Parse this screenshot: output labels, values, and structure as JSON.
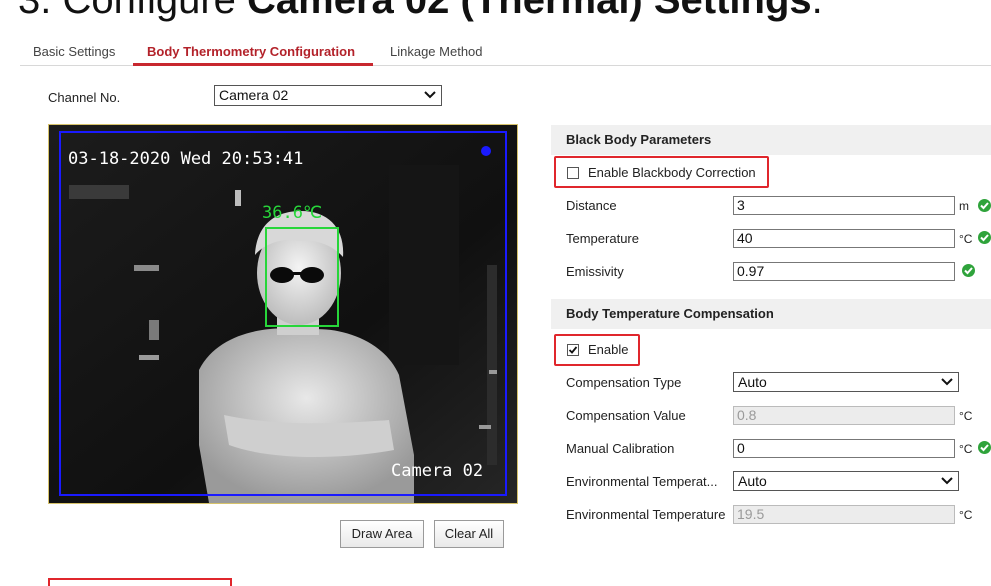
{
  "doc_title": {
    "prefix": "3. Configure ",
    "bold": "Camera 02 (Thermal) Settings",
    "suffix": "."
  },
  "tabs": [
    {
      "label": "Basic Settings",
      "active": false
    },
    {
      "label": "Body Thermometry Configuration",
      "active": true
    },
    {
      "label": "Linkage Method",
      "active": false
    }
  ],
  "channel": {
    "label": "Channel No.",
    "value": "Camera 02"
  },
  "video": {
    "timestamp": "03-18-2020 Wed 20:53:41",
    "temperature": "36.6℃",
    "camera_name": "Camera 02"
  },
  "buttons": {
    "draw_area": "Draw Area",
    "clear_all": "Clear All"
  },
  "blackbody": {
    "title": "Black Body Parameters",
    "enable_label": "Enable Blackbody Correction",
    "enable_checked": false,
    "distance_label": "Distance",
    "distance_value": "3",
    "distance_unit": "m",
    "temperature_label": "Temperature",
    "temperature_value": "40",
    "temperature_unit": "°C",
    "emissivity_label": "Emissivity",
    "emissivity_value": "0.97"
  },
  "compensation": {
    "title": "Body Temperature Compensation",
    "enable_label": "Enable",
    "enable_checked": true,
    "type_label": "Compensation Type",
    "type_value": "Auto",
    "value_label": "Compensation Value",
    "value_value": "0.8",
    "value_unit": "°C",
    "manual_label": "Manual Calibration",
    "manual_value": "0",
    "manual_unit": "°C",
    "env_mode_label": "Environmental Temperat...",
    "env_mode_value": "Auto",
    "env_temp_label": "Environmental Temperature",
    "env_temp_value": "19.5",
    "env_temp_unit": "°C"
  },
  "colors": {
    "accent": "#c8272f",
    "highlight": "#e0262c",
    "ok": "#2fa33b",
    "osd_box": "#1a1aff",
    "face_box": "#27d63a"
  }
}
